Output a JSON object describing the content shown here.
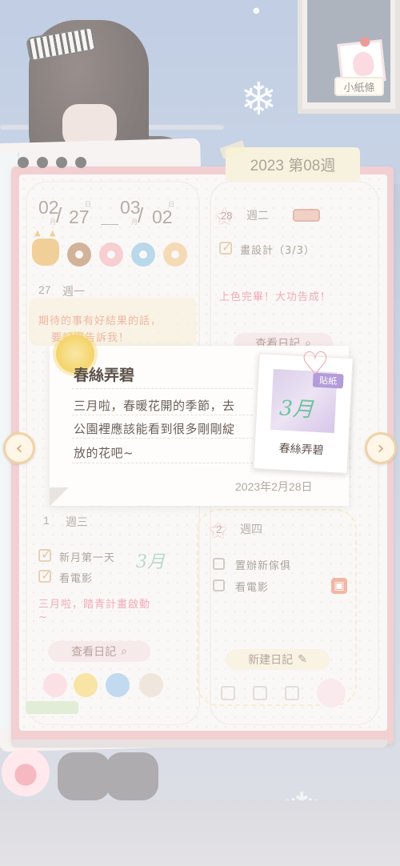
{
  "scene": {
    "frame_label": "小紙條"
  },
  "notebook": {
    "week_tab": "2023 第08週",
    "date_range": {
      "start_month": "02",
      "start_day": "27",
      "end_month": "03",
      "end_day": "02",
      "month_unit": "月",
      "day_unit": "日"
    },
    "left_top": {
      "day_number": "27",
      "weekday": "週一",
      "note_lines": [
        "期待的事有好結果的話，",
        "要記得告訴我！"
      ]
    },
    "right_top": {
      "day_number": "28",
      "weekday": "週二",
      "task": "畫設計（3/3）",
      "note": "上色完畢！大功告成！",
      "view_button": "查看日記"
    },
    "left_bottom": {
      "day_number": "1",
      "weekday": "週三",
      "tasks": [
        {
          "label": "新月第一天",
          "done": true
        },
        {
          "label": "看電影",
          "done": true
        }
      ],
      "note_lines": [
        "三月啦，踏青計畫啟動",
        "~"
      ],
      "view_button": "查看日記"
    },
    "right_bottom": {
      "day_number": "2",
      "weekday": "週四",
      "tasks": [
        {
          "label": "置辦新傢俱",
          "done": false
        },
        {
          "label": "看電影",
          "done": false
        }
      ],
      "new_button": "新建日記"
    }
  },
  "popup": {
    "title": "春絲弄碧",
    "body_lines": [
      "三月啦，春暖花開的季節，去",
      "公園裡應該能看到很多剛剛綻",
      "放的花吧~"
    ],
    "date": "2023年2月28日",
    "sticker": {
      "tag": "貼紙",
      "caption": "春絲弄碧"
    }
  },
  "icons": {
    "prev": "chevron-left-icon",
    "next": "chevron-right-icon",
    "search": "search-icon",
    "edit": "pencil-icon",
    "gift": "gift-icon"
  },
  "colors": {
    "book_cover": "#ebb3b6",
    "note_pink": "#e8788b",
    "button_pink": "#f3dedd",
    "button_yellow": "#f4ecd1",
    "arrow_border": "#efd2a8"
  }
}
